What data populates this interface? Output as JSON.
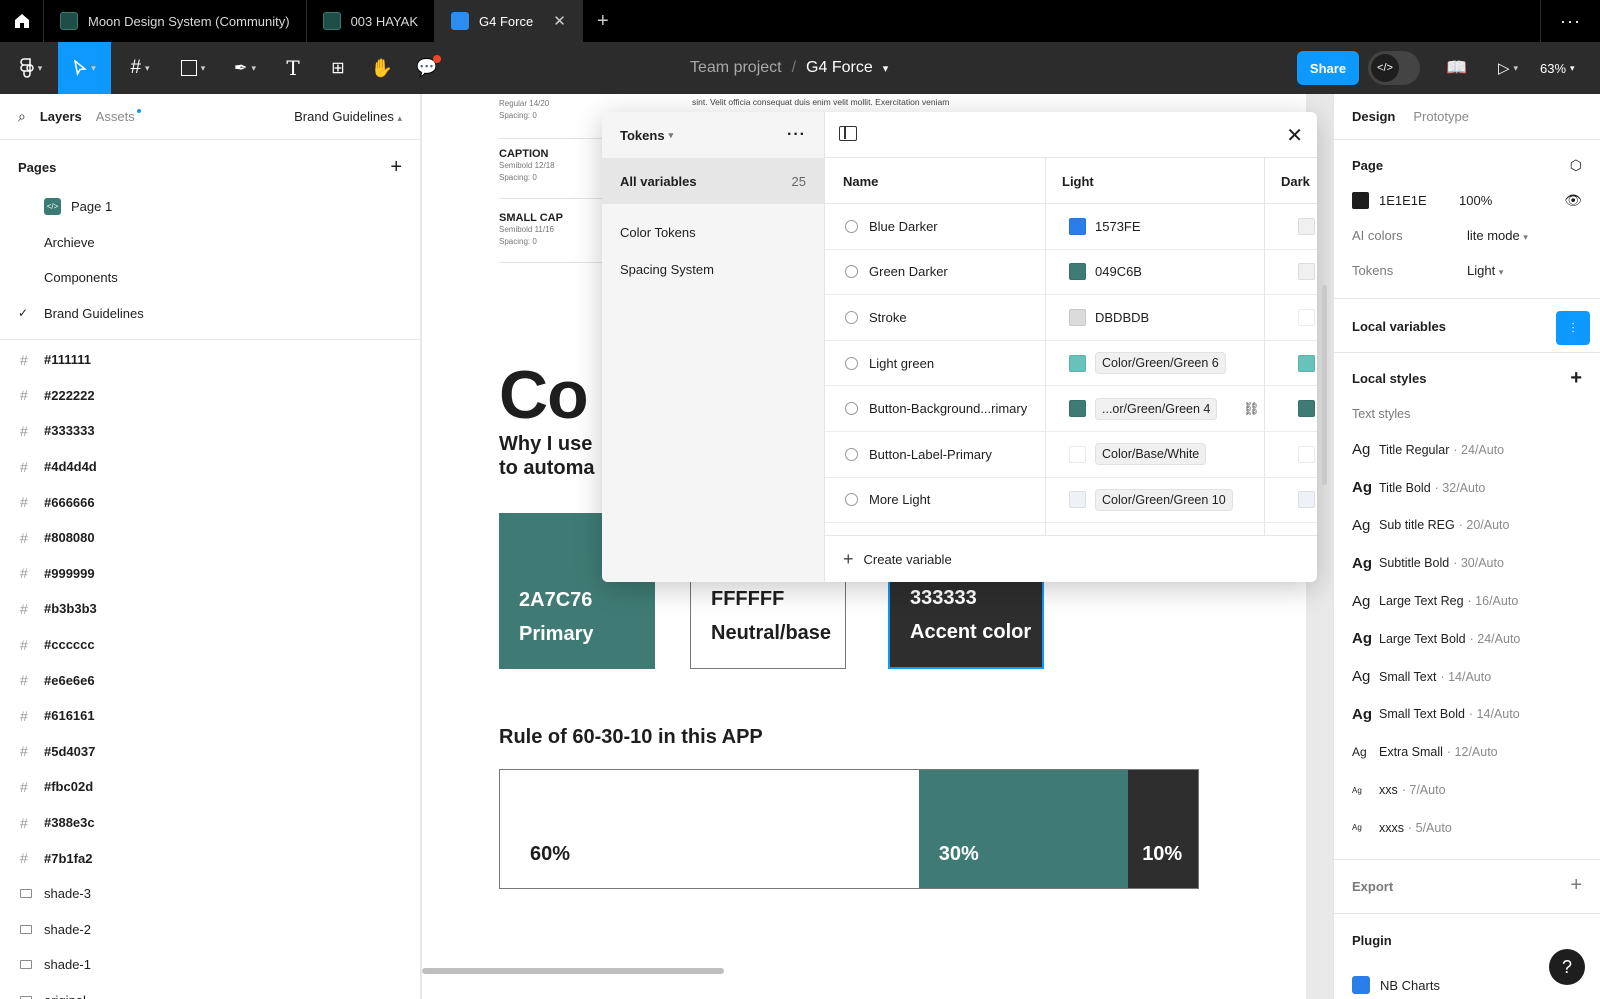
{
  "tabs": {
    "items": [
      {
        "label": "Moon Design System (Community)"
      },
      {
        "label": "003 HAYAK"
      },
      {
        "label": "G4 Force"
      }
    ]
  },
  "toolbar": {
    "team": "Team project",
    "slash": "/",
    "file": "G4 Force",
    "share": "Share",
    "zoom": "63%"
  },
  "left": {
    "tab_layers": "Layers",
    "tab_assets": "Assets",
    "current_page": "Brand Guidelines",
    "pages_title": "Pages",
    "pages": [
      {
        "label": "Page 1"
      },
      {
        "label": "Archieve"
      },
      {
        "label": "Components"
      },
      {
        "label": "Brand Guidelines"
      }
    ],
    "layers": [
      {
        "label": "#111111"
      },
      {
        "label": "#222222"
      },
      {
        "label": "#333333"
      },
      {
        "label": "#4d4d4d"
      },
      {
        "label": "#666666"
      },
      {
        "label": "#808080"
      },
      {
        "label": "#999999"
      },
      {
        "label": "#b3b3b3"
      },
      {
        "label": "#cccccc"
      },
      {
        "label": "#e6e6e6"
      },
      {
        "label": "#616161"
      },
      {
        "label": "#5d4037"
      },
      {
        "label": "#fbc02d"
      },
      {
        "label": "#388e3c"
      },
      {
        "label": "#7b1fa2"
      },
      {
        "label": "shade-3"
      },
      {
        "label": "shade-2"
      },
      {
        "label": "shade-1"
      },
      {
        "label": "original"
      }
    ]
  },
  "canvas": {
    "lorem": "sint. Velit officia consequat duis enim velit mollit. Exercitation veniam",
    "blocks": [
      {
        "h": "",
        "s1": "Regular 14/20",
        "s2": "Spacing: 0"
      },
      {
        "h": "CAPTION",
        "s1": "Semibold 12/18",
        "s2": "Spacing: 0"
      },
      {
        "h": "SMALL CAP",
        "s1": "Semibold 11/16",
        "s2": "Spacing: 0"
      }
    ],
    "big": "Co",
    "why1": "Why I use",
    "why2": "to automa",
    "swatches": [
      {
        "hex": "2A7C76",
        "name": "Primary",
        "bg": "#3f7b74",
        "fg": "#ffffff"
      },
      {
        "hex": "FFFFFF",
        "name": "Neutral/base",
        "bg": "#ffffff",
        "fg": "#1e1e1e"
      },
      {
        "hex": "333333",
        "name": "Accent color",
        "bg": "#2e2e2e",
        "fg": "#ffffff"
      }
    ],
    "rule": "Rule of 60-30-10 in this APP",
    "bars": [
      {
        "label": "60%",
        "pct": 60,
        "bg": "#ffffff",
        "fg": "#1e1e1e"
      },
      {
        "label": "30%",
        "pct": 30,
        "bg": "#3f7b74",
        "fg": "#ffffff"
      },
      {
        "label": "10%",
        "pct": 10,
        "bg": "#2e2e2e",
        "fg": "#ffffff"
      }
    ]
  },
  "modal": {
    "collection": "Tokens",
    "all": "All variables",
    "count": "25",
    "groups": [
      "Color Tokens",
      "Spacing System"
    ],
    "cols": {
      "name": "Name",
      "light": "Light",
      "dark": "Dark"
    },
    "rows": [
      {
        "name": "Blue Darker",
        "light": "1573FE",
        "light_color": "#2b7de9",
        "pill": false,
        "dark_color": "#f0f0f0"
      },
      {
        "name": "Green Darker",
        "light": "049C6B",
        "light_color": "#3d7b74",
        "pill": false,
        "dark_color": "#f0f0f0"
      },
      {
        "name": "Stroke",
        "light": "DBDBDB",
        "light_color": "#dbdbdb",
        "pill": false,
        "dark_color": "#ffffff"
      },
      {
        "name": "Light green",
        "light": "Color/Green/Green 6",
        "light_color": "#67c2b9",
        "pill": true,
        "dark_color": "#67c2b9"
      },
      {
        "name": "Button-Background...rimary",
        "light": "...or/Green/Green 4",
        "light_color": "#3d7b74",
        "pill": true,
        "dark_color": "#3d7b74"
      },
      {
        "name": "Button-Label-Primary",
        "light": "Color/Base/White",
        "light_color": "#ffffff",
        "pill": true,
        "dark_color": "#ffffff"
      },
      {
        "name": "More Light",
        "light": "Color/Green/Green 10",
        "light_color": "#eef2f8",
        "pill": true,
        "dark_color": "#eef2f8"
      },
      {
        "name": "",
        "light": "",
        "light_color": "#1e1e1e",
        "pill": false,
        "dark_color": "#f0f0f0"
      }
    ],
    "create": "Create variable"
  },
  "right": {
    "tab_design": "Design",
    "tab_proto": "Prototype",
    "page_title": "Page",
    "page_color": "1E1E1E",
    "page_opacity": "100%",
    "ai_label": "AI colors",
    "ai_value": "lite mode",
    "tokens_label": "Tokens",
    "tokens_value": "Light",
    "local_vars": "Local variables",
    "local_styles": "Local styles",
    "text_styles": "Text styles",
    "styles": [
      {
        "name": "Title Regular",
        "meta": "· 24/Auto",
        "bold": false
      },
      {
        "name": "Title Bold",
        "meta": "· 32/Auto",
        "bold": true
      },
      {
        "name": "Sub title REG",
        "meta": "· 20/Auto",
        "bold": false
      },
      {
        "name": "Subtitle Bold",
        "meta": "· 30/Auto",
        "bold": true
      },
      {
        "name": "Large Text Reg",
        "meta": "· 16/Auto",
        "bold": false
      },
      {
        "name": "Large Text Bold",
        "meta": "· 24/Auto",
        "bold": true
      },
      {
        "name": "Small Text",
        "meta": "· 14/Auto",
        "bold": false
      },
      {
        "name": "Small Text Bold",
        "meta": "· 14/Auto",
        "bold": true
      },
      {
        "name": "Extra Small",
        "meta": "· 12/Auto",
        "bold": false
      },
      {
        "name": "xxs",
        "meta": "· 7/Auto",
        "bold": false
      },
      {
        "name": "xxxs",
        "meta": "· 5/Auto",
        "bold": false
      }
    ],
    "export": "Export",
    "plugin": "Plugin",
    "plugin_item": "NB Charts"
  },
  "help": "?"
}
